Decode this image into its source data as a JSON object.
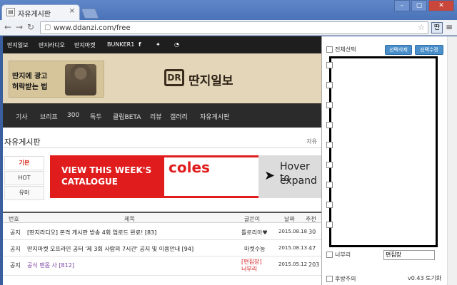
{
  "browser": {
    "tab_title": "자유게시판",
    "tab_close": "×",
    "url": "www.ddanzi.com/free",
    "ext_icon": "딴",
    "win_min": "–",
    "win_max": "▢",
    "win_close": "✕"
  },
  "topnav": [
    "딴지일보",
    "딴지라디오",
    "딴지마켓",
    "BUNKER1"
  ],
  "ad": {
    "line1": "딴지에 광고",
    "line2": "허락받는 법"
  },
  "logo": {
    "mark": "DR",
    "text": "딴지일보"
  },
  "mainnav": [
    "기사",
    "브리프",
    "300",
    "독두",
    "클립BETA",
    "리뷰",
    "갤러리",
    "자유게시판"
  ],
  "board": {
    "title": "자유게시판",
    "right": "자유"
  },
  "sidetabs": [
    "기본",
    "HOT",
    "유머"
  ],
  "banner": {
    "line1": "VIEW THIS WEEK'S",
    "line2": "CATALOGUE",
    "brand": "coles",
    "right1": "Hover to",
    "right2": "expand"
  },
  "table": {
    "headers": [
      "번호",
      "제목",
      "글쓴이",
      "날짜",
      "추천"
    ],
    "rows": [
      {
        "num": "공지",
        "title": "[딴지라디오] 본격 게시판 방송 4회 업로드 완료! [83]",
        "author": "틀로리아♥",
        "date": "2015.08.18",
        "votes": "30"
      },
      {
        "num": "공지",
        "title": "딴지마켓 오프라인 공터 '제 3회 사람의 7시간' 공지 및 이용안내 [94]",
        "author": "마켓수눙",
        "date": "2015.08.13",
        "votes": "47"
      },
      {
        "num": "공지",
        "title": "공식 맨몸 사 [812]",
        "author": "[편집장]\n너부리",
        "date": "2015.05.12",
        "votes": "203"
      }
    ]
  },
  "panel": {
    "select_all": "전체선택",
    "btn_delete": "선택삭제",
    "btn_edit": "선택수정",
    "nick_label": "너부리",
    "nick_value": "편집장",
    "bottom_label": "후방주의",
    "version": "v0.43 토기화"
  },
  "colors": {
    "accent": "#4a8fc9",
    "banner_red": "#e01c1c",
    "nav_dark": "#2b2b2b"
  }
}
